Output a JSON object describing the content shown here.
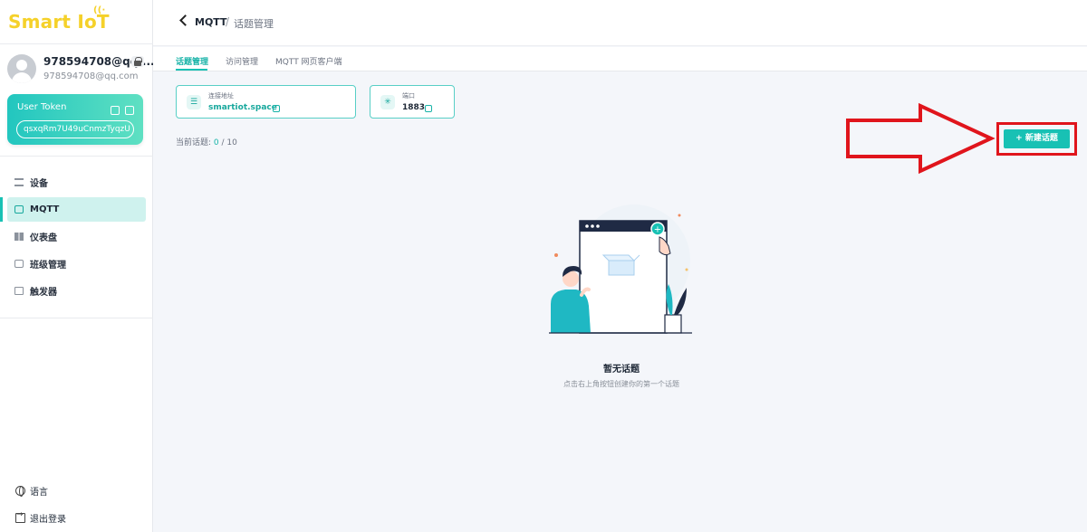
{
  "app": {
    "logo_text": "Smart IoT"
  },
  "user": {
    "name": "978594708@qq....",
    "email": "978594708@qq.com"
  },
  "token": {
    "title": "User Token",
    "value": "qsxqRm7U49uCnmzTyqzU"
  },
  "sidebar": {
    "items": [
      {
        "label": "设备",
        "icon": "device-icon",
        "active": false
      },
      {
        "label": "MQTT",
        "icon": "chat-icon",
        "active": true
      },
      {
        "label": "仪表盘",
        "icon": "dashboard-icon",
        "active": false
      },
      {
        "label": "班级管理",
        "icon": "class-icon",
        "active": false
      },
      {
        "label": "触发器",
        "icon": "trigger-icon",
        "active": false
      }
    ],
    "language_label": "语言",
    "logout_label": "退出登录"
  },
  "header": {
    "crumb_root": "MQTT",
    "separator": "/",
    "crumb_current": "话题管理"
  },
  "tabs": [
    {
      "label": "话题管理",
      "active": true
    },
    {
      "label": "访问管理",
      "active": false
    },
    {
      "label": "MQTT 网页客户端",
      "active": false
    }
  ],
  "connection": {
    "host_label": "连接地址",
    "host_value": "smartiot.space",
    "port_label": "端口",
    "port_value": "1883"
  },
  "topics": {
    "count_label": "当前话题:",
    "current": "0",
    "max": "/ 10",
    "new_button": "+ 新建话题"
  },
  "empty_state": {
    "title": "暂无话题",
    "description": "点击右上角按钮创建你的第一个话题"
  },
  "colors": {
    "accent": "#18c1b4",
    "annotation": "#e0151c",
    "logo": "#f5d12a"
  }
}
